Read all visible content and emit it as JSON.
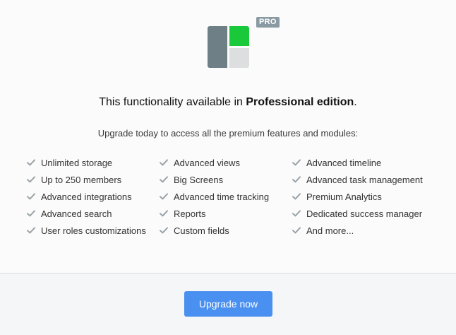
{
  "badge": {
    "label": "PRO"
  },
  "logo": {
    "icon": "app-logo-icon",
    "colors": {
      "left": "#6f7f86",
      "top_right": "#19c93a",
      "bottom_right": "#dcdedf"
    }
  },
  "headline": {
    "prefix": "This functionality available in ",
    "emphasis": "Professional edition",
    "suffix": "."
  },
  "subline": "Upgrade today to access all the premium features and modules:",
  "features": {
    "check_icon": "check-icon",
    "columns": [
      [
        "Unlimited storage",
        "Up to 250 members",
        "Advanced integrations",
        "Advanced search",
        "User roles customizations"
      ],
      [
        "Advanced views",
        "Big Screens",
        "Advanced time tracking",
        "Reports",
        "Custom fields"
      ],
      [
        "Advanced timeline",
        "Advanced task management",
        "Premium Analytics",
        "Dedicated success manager",
        "And more..."
      ]
    ]
  },
  "footer": {
    "upgrade_label": "Upgrade now"
  },
  "colors": {
    "accent": "#4a90f0",
    "badge": "#8a9aa2",
    "check": "#9aa3a8"
  }
}
